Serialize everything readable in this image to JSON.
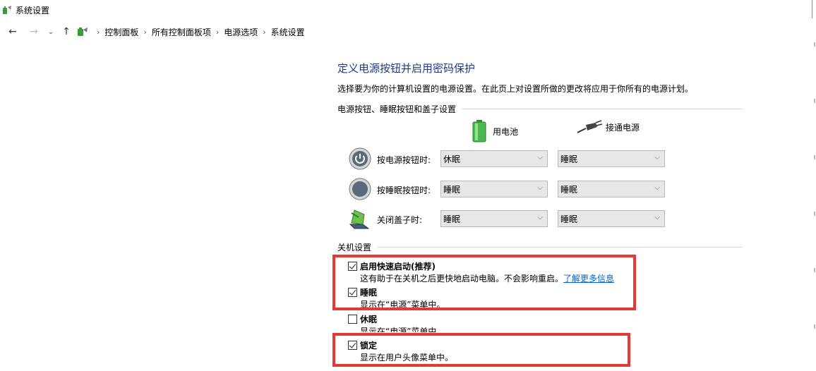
{
  "window": {
    "title": "系统设置",
    "icon": "power-options-icon"
  },
  "nav": {
    "back": "←",
    "forward": "→",
    "recent": "⌄",
    "up": "↑",
    "breadcrumb": [
      "控制面板",
      "所有控制面板项",
      "电源选项",
      "系统设置"
    ],
    "separator": "›"
  },
  "main": {
    "title": "定义电源按钮并启用密码保护",
    "description": "选择要为你的计算机设置的电源设置。在此页上对设置所做的更改将应用于你所有的电源计划。",
    "buttons_group": "电源按钮、睡眠按钮和盖子设置",
    "columns": {
      "battery": "用电池",
      "plugged": "接通电源"
    },
    "rows": [
      {
        "label": "按电源按钮时:",
        "icon": "power-button-icon",
        "battery": "休眠",
        "plugged": "睡眠"
      },
      {
        "label": "按睡眠按钮时:",
        "icon": "sleep-button-icon",
        "battery": "睡眠",
        "plugged": "睡眠"
      },
      {
        "label": "关闭盖子时:",
        "icon": "laptop-lid-icon",
        "battery": "睡眠",
        "plugged": "睡眠"
      }
    ],
    "shutdown_group": "关机设置",
    "shutdown_options": [
      {
        "label": "启用快速启动(推荐)",
        "checked": true,
        "desc": "这有助于在关机之后更快地启动电脑。不会影响重启。",
        "link": "了解更多信息"
      },
      {
        "label": "睡眠",
        "checked": true,
        "desc": "显示在“电源”菜单中。"
      },
      {
        "label": "休眠",
        "checked": false,
        "desc": "显示在“电源”菜单中。"
      },
      {
        "label": "锁定",
        "checked": true,
        "desc": "显示在用户头像菜单中。"
      }
    ]
  },
  "colors": {
    "title": "#1e3a8a",
    "link": "#0066cc",
    "highlight": "#e53935"
  }
}
